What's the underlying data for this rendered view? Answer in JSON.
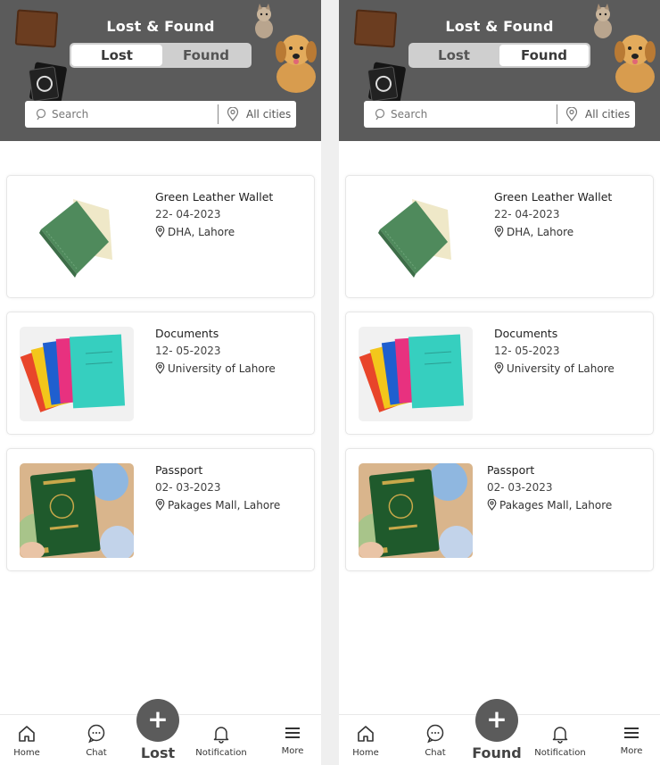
{
  "screens": [
    {
      "header": {
        "title": "Lost & Found",
        "lost_label": "Lost",
        "found_label": "Found",
        "active": "lost"
      },
      "search": {
        "placeholder": "Search",
        "city": "All cities"
      },
      "items": [
        {
          "name": "Green Leather Wallet",
          "date": "22- 04-2023",
          "location": "DHA, Lahore",
          "thumb": "wallet"
        },
        {
          "name": "Documents",
          "date": "12- 05-2023",
          "location": "University of Lahore",
          "thumb": "folders"
        },
        {
          "name": "Passport",
          "date": "02- 03-2023",
          "location": "Pakages Mall, Lahore",
          "thumb": "passport"
        }
      ],
      "tabbar": {
        "home": "Home",
        "chat": "Chat",
        "center": "Lost",
        "notification": "Notification",
        "more": "More",
        "fab_symbol": "+"
      }
    },
    {
      "header": {
        "title": "Lost & Found",
        "lost_label": "Lost",
        "found_label": "Found",
        "active": "found"
      },
      "search": {
        "placeholder": "Search",
        "city": "All cities"
      },
      "items": [
        {
          "name": "Green Leather Wallet",
          "date": "22- 04-2023",
          "location": "DHA, Lahore",
          "thumb": "wallet"
        },
        {
          "name": "Documents",
          "date": "12- 05-2023",
          "location": "University of Lahore",
          "thumb": "folders"
        },
        {
          "name": "Passport",
          "date": "02- 03-2023",
          "location": "Pakages Mall, Lahore",
          "thumb": "passport"
        }
      ],
      "tabbar": {
        "home": "Home",
        "chat": "Chat",
        "center": "Found",
        "notification": "Notification",
        "more": "More",
        "fab_symbol": "+"
      }
    }
  ],
  "colors": {
    "header_bg": "#5b5b5b",
    "wallet_green": "#4f8a5c",
    "fab_bg": "#5b5b5b"
  }
}
